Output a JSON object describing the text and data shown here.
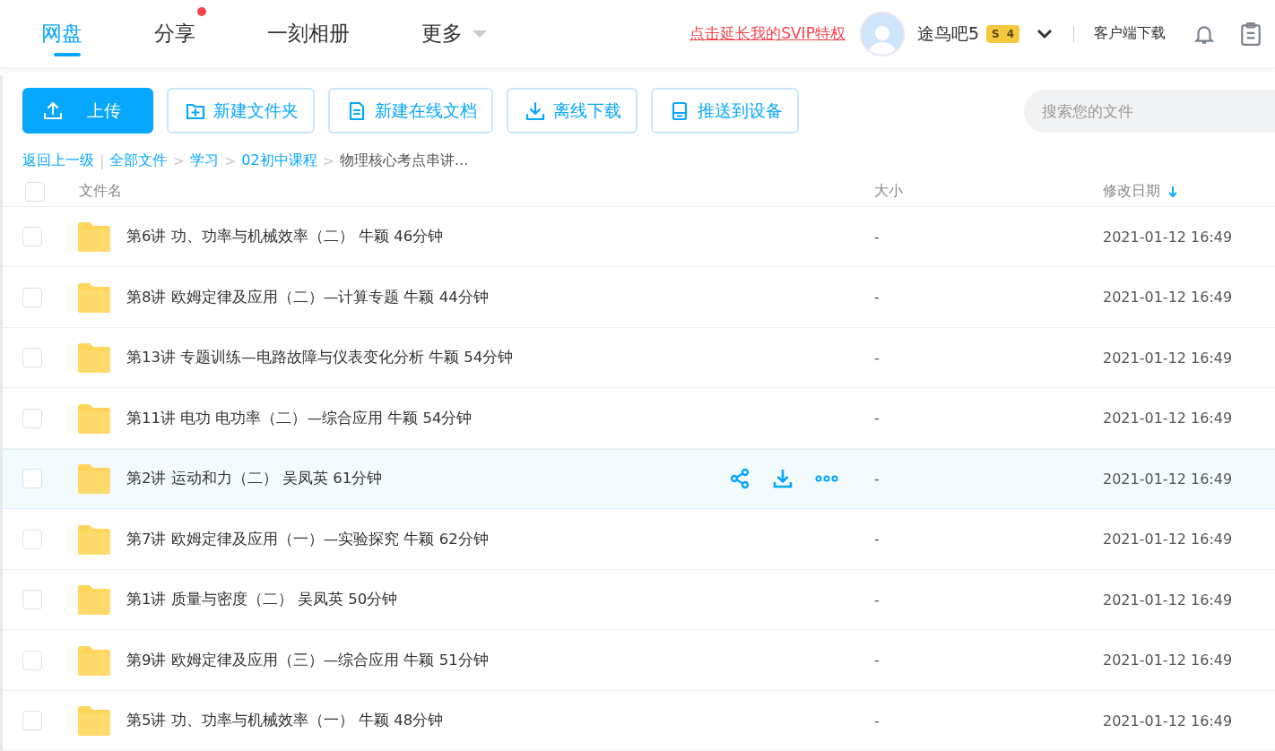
{
  "nav": {
    "tabs": [
      {
        "label": "网盘",
        "selected": true,
        "dot": false,
        "caret": false
      },
      {
        "label": "分享",
        "selected": false,
        "dot": true,
        "caret": false
      },
      {
        "label": "一刻相册",
        "selected": false,
        "dot": false,
        "caret": false
      },
      {
        "label": "更多",
        "selected": false,
        "dot": false,
        "caret": true
      }
    ],
    "promo": "点击延长我的SVIP特权",
    "username": "途鸟吧5",
    "badge": {
      "letter": "S",
      "tier": "4"
    },
    "client_download": "客户端下载"
  },
  "toolbar": {
    "buttons": [
      {
        "label": "上传",
        "kind": "upload",
        "primary": true
      },
      {
        "label": "新建文件夹",
        "kind": "folder",
        "primary": false
      },
      {
        "label": "新建在线文档",
        "kind": "doc",
        "primary": false
      },
      {
        "label": "离线下载",
        "kind": "download",
        "primary": false
      },
      {
        "label": "推送到设备",
        "kind": "device",
        "primary": false
      }
    ],
    "search": {
      "placeholder": "搜索您的文件"
    }
  },
  "breadcrumb": {
    "back": "返回上一级",
    "back_separator": "|",
    "path_separator": ">",
    "path": [
      "全部文件",
      "学习",
      "02初中课程"
    ],
    "current": "物理核心考点串讲..."
  },
  "table": {
    "columns": [
      "文件名",
      "大小",
      "修改日期"
    ],
    "sort_desc": true,
    "all_checked": false,
    "rows": [
      {
        "name": "第6讲 功、功率与机械效率（二） 牛颖 46分钟",
        "size": "-",
        "modified": "2021-01-12 16:49",
        "hovered": false,
        "checked": false
      },
      {
        "name": "第8讲 欧姆定律及应用（二）—计算专题 牛颖 44分钟",
        "size": "-",
        "modified": "2021-01-12 16:49",
        "hovered": false,
        "checked": false
      },
      {
        "name": "第13讲 专题训练—电路故障与仪表变化分析 牛颖 54分钟",
        "size": "-",
        "modified": "2021-01-12 16:49",
        "hovered": false,
        "checked": false
      },
      {
        "name": "第11讲 电功 电功率（二）—综合应用 牛颖 54分钟",
        "size": "-",
        "modified": "2021-01-12 16:49",
        "hovered": false,
        "checked": false
      },
      {
        "name": "第2讲 运动和力（二） 吴凤英 61分钟",
        "size": "-",
        "modified": "2021-01-12 16:49",
        "hovered": true,
        "checked": false
      },
      {
        "name": "第7讲 欧姆定律及应用（一）—实验探究 牛颖 62分钟",
        "size": "-",
        "modified": "2021-01-12 16:49",
        "hovered": false,
        "checked": false
      },
      {
        "name": "第1讲 质量与密度（二） 吴凤英 50分钟",
        "size": "-",
        "modified": "2021-01-12 16:49",
        "hovered": false,
        "checked": false
      },
      {
        "name": "第9讲 欧姆定律及应用（三）—综合应用 牛颖 51分钟",
        "size": "-",
        "modified": "2021-01-12 16:49",
        "hovered": false,
        "checked": false
      },
      {
        "name": "第5讲 功、功率与机械效率（一） 牛颖 48分钟",
        "size": "-",
        "modified": "2021-01-12 16:49",
        "hovered": false,
        "checked": false
      }
    ]
  }
}
